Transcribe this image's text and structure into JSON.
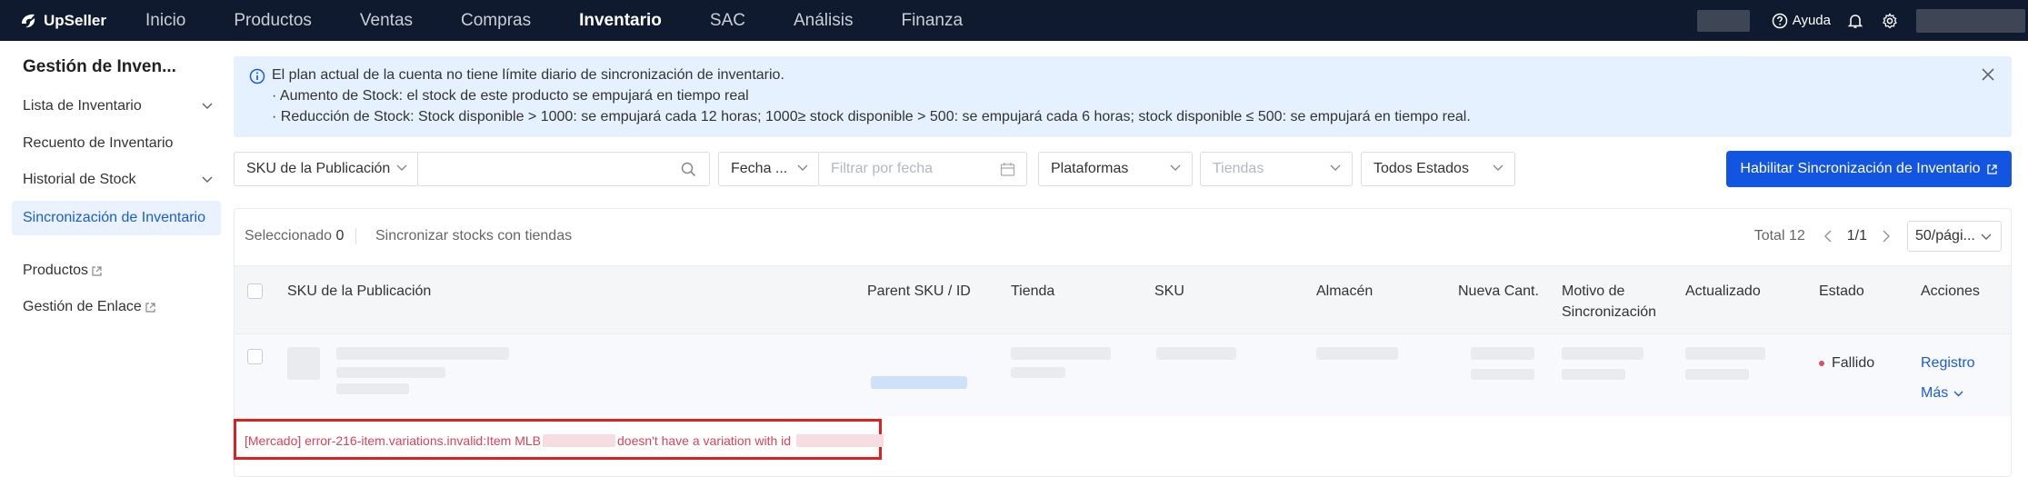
{
  "app": {
    "name": "UpSeller"
  },
  "nav": {
    "items": [
      "Inicio",
      "Productos",
      "Ventas",
      "Compras",
      "Inventario",
      "SAC",
      "Análisis",
      "Finanza"
    ],
    "active_index": 4
  },
  "header": {
    "help_label": "Ayuda"
  },
  "sidebar": {
    "title": "Gestión de Inven...",
    "items": [
      {
        "label": "Lista de Inventario",
        "expandable": true
      },
      {
        "label": "Recuento de Inventario",
        "expandable": false
      },
      {
        "label": "Historial de Stock",
        "expandable": true
      },
      {
        "label": "Sincronización de Inventario",
        "expandable": false,
        "active": true
      },
      {
        "label": "Productos",
        "external": true
      },
      {
        "label": "Gestión de Enlace",
        "external": true
      }
    ]
  },
  "banner": {
    "line1": "El plan actual de la cuenta no tiene límite diario de sincronización de inventario.",
    "line2": "· Aumento de Stock: el stock de este producto se empujará en tiempo real",
    "line3": "· Reducción de Stock: Stock disponible > 1000: se empujará cada 12 horas; 1000≥ stock disponible > 500: se empujará cada 6 horas; stock disponible ≤ 500: se empujará en tiempo real."
  },
  "filters": {
    "sku_type": "SKU de la Publicación",
    "search_placeholder": "",
    "date_type": "Fecha ...",
    "date_placeholder": "Filtrar por fecha",
    "platforms": "Plataformas",
    "stores_placeholder": "Tiendas",
    "status": "Todos Estados"
  },
  "actions": {
    "enable_sync": "Habilitar Sincronización de Inventario"
  },
  "toolbar": {
    "selected_label": "Seleccionado",
    "selected_count": "0",
    "sync_label": "Sincronizar stocks con tiendas",
    "total": "Total 12",
    "page": "1/1",
    "page_size": "50/pági..."
  },
  "table": {
    "columns": [
      "SKU de la Publicación",
      "Parent SKU / ID",
      "Tienda",
      "SKU",
      "Almacén",
      "Nueva Cant.",
      "Motivo de Sincronización",
      "Actualizado",
      "Estado",
      "Acciones"
    ],
    "rows": [
      {
        "status": "Fallido",
        "action_log": "Registro",
        "action_more": "Más"
      }
    ]
  },
  "error": {
    "prefix": "[Mercado] error-216-item.variations.invalid:Item MLB",
    "middle": "doesn't have a variation with id"
  },
  "colors": {
    "accent": "#1155e0",
    "nav_bg": "#0f1a2e",
    "error": "#e0201f",
    "failed_dot": "#e34d59"
  }
}
